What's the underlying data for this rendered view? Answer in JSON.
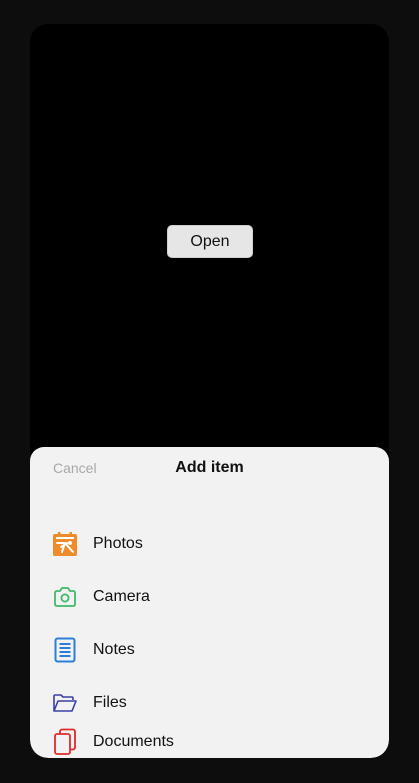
{
  "main": {
    "open_label": "Open"
  },
  "sheet": {
    "cancel_label": "Cancel",
    "title": "Add item",
    "items": [
      {
        "label": "Photos",
        "icon": "photos-icon",
        "color": "#f08a2b"
      },
      {
        "label": "Camera",
        "icon": "camera-icon",
        "color": "#3dba6a"
      },
      {
        "label": "Notes",
        "icon": "notes-icon",
        "color": "#2b7fd9"
      },
      {
        "label": "Files",
        "icon": "folder-icon",
        "color": "#3a3fa8"
      },
      {
        "label": "Documents",
        "icon": "documents-icon",
        "color": "#e02a2a"
      }
    ]
  }
}
